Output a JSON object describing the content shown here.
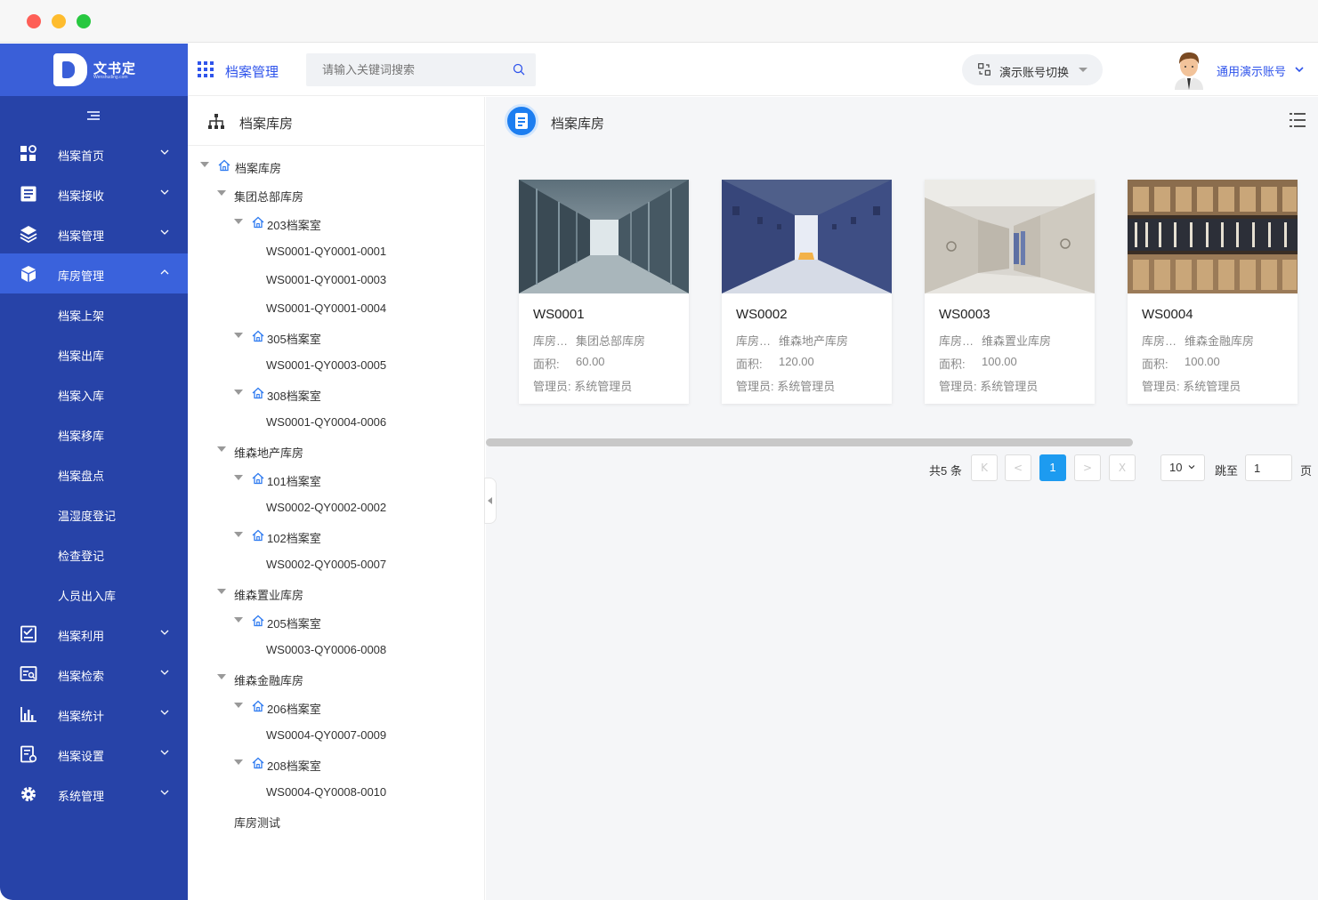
{
  "sidebar": {
    "logo_text": "文书定",
    "logo_sub": "Wenshuding.com",
    "menu": [
      {
        "label": "档案首页",
        "icon": "dashboard-icon",
        "expanded": false
      },
      {
        "label": "档案接收",
        "icon": "receive-icon",
        "expanded": false
      },
      {
        "label": "档案管理",
        "icon": "layers-icon",
        "expanded": false
      },
      {
        "label": "库房管理",
        "icon": "cube-icon",
        "expanded": true,
        "active": true
      },
      {
        "label": "档案利用",
        "icon": "checklist-icon",
        "expanded": false
      },
      {
        "label": "档案检索",
        "icon": "search-doc-icon",
        "expanded": false
      },
      {
        "label": "档案统计",
        "icon": "bar-chart-icon",
        "expanded": false
      },
      {
        "label": "档案设置",
        "icon": "doc-settings-icon",
        "expanded": false
      },
      {
        "label": "系统管理",
        "icon": "gear-icon",
        "expanded": false
      }
    ],
    "submenu": [
      "档案上架",
      "档案出库",
      "档案入库",
      "档案移库",
      "档案盘点",
      "温湿度登记",
      "检查登记",
      "人员出入库"
    ]
  },
  "topbar": {
    "module_title": "档案管理",
    "search_placeholder": "请输入关键词搜索",
    "switch_label": "演示账号切换",
    "user_name": "通用演示账号"
  },
  "tree_panel": {
    "title": "档案库房",
    "nodes": [
      {
        "label": "档案库房",
        "level": 0,
        "caret": true,
        "home": true
      },
      {
        "label": "集团总部库房",
        "level": 1,
        "caret": true,
        "home": false
      },
      {
        "label": "203档案室",
        "level": 2,
        "caret": true,
        "home": true
      },
      {
        "label": "WS0001-QY0001-0001",
        "level": 3,
        "caret": false,
        "home": false
      },
      {
        "label": "WS0001-QY0001-0003",
        "level": 3,
        "caret": false,
        "home": false
      },
      {
        "label": "WS0001-QY0001-0004",
        "level": 3,
        "caret": false,
        "home": false
      },
      {
        "label": "305档案室",
        "level": 2,
        "caret": true,
        "home": true
      },
      {
        "label": "WS0001-QY0003-0005",
        "level": 3,
        "caret": false,
        "home": false
      },
      {
        "label": "308档案室",
        "level": 2,
        "caret": true,
        "home": true
      },
      {
        "label": "WS0001-QY0004-0006",
        "level": 3,
        "caret": false,
        "home": false
      },
      {
        "label": "维森地产库房",
        "level": 1,
        "caret": true,
        "home": false
      },
      {
        "label": "101档案室",
        "level": 2,
        "caret": true,
        "home": true
      },
      {
        "label": "WS0002-QY0002-0002",
        "level": 3,
        "caret": false,
        "home": false
      },
      {
        "label": "102档案室",
        "level": 2,
        "caret": true,
        "home": true
      },
      {
        "label": "WS0002-QY0005-0007",
        "level": 3,
        "caret": false,
        "home": false
      },
      {
        "label": "维森置业库房",
        "level": 1,
        "caret": true,
        "home": false
      },
      {
        "label": "205档案室",
        "level": 2,
        "caret": true,
        "home": true
      },
      {
        "label": "WS0003-QY0006-0008",
        "level": 3,
        "caret": false,
        "home": false
      },
      {
        "label": "维森金融库房",
        "level": 1,
        "caret": true,
        "home": false
      },
      {
        "label": "206档案室",
        "level": 2,
        "caret": true,
        "home": true
      },
      {
        "label": "WS0004-QY0007-0009",
        "level": 3,
        "caret": false,
        "home": false
      },
      {
        "label": "208档案室",
        "level": 2,
        "caret": true,
        "home": true
      },
      {
        "label": "WS0004-QY0008-0010",
        "level": 3,
        "caret": false,
        "home": false
      },
      {
        "label": "库房测试",
        "level": 1,
        "caret": false,
        "home": false
      }
    ]
  },
  "content": {
    "title": "档案库房",
    "cards": [
      {
        "code": "WS0001",
        "warehouse_key": "库房…",
        "warehouse": "集团总部库房",
        "area_key": "面积:",
        "area": "60.00",
        "manager_key": "管理员:",
        "manager": "系统管理员",
        "image": "glass-corridor"
      },
      {
        "code": "WS0002",
        "warehouse_key": "库房…",
        "warehouse": "维森地产库房",
        "area_key": "面积:",
        "area": "120.00",
        "manager_key": "管理员:",
        "manager": "系统管理员",
        "image": "blue-cabinets"
      },
      {
        "code": "WS0003",
        "warehouse_key": "库房…",
        "warehouse": "维森置业库房",
        "area_key": "面积:",
        "area": "100.00",
        "manager_key": "管理员:",
        "manager": "系统管理员",
        "image": "mobile-shelving"
      },
      {
        "code": "WS0004",
        "warehouse_key": "库房…",
        "warehouse": "维森金融库房",
        "area_key": "面积:",
        "area": "100.00",
        "manager_key": "管理员:",
        "manager": "系统管理员",
        "image": "book-shelves"
      }
    ],
    "pager": {
      "total": "共5 条",
      "first": "K",
      "prev": "<",
      "current": "1",
      "next": ">",
      "last": "X",
      "page_size": "10",
      "jump_label": "跳至",
      "jump_value": "1",
      "page_unit": "页"
    }
  },
  "colors": {
    "sidebar": "#2743a8",
    "sidebar_active": "#3a62dc",
    "accent": "#2f54eb",
    "pager_current": "#1d9bf0"
  }
}
